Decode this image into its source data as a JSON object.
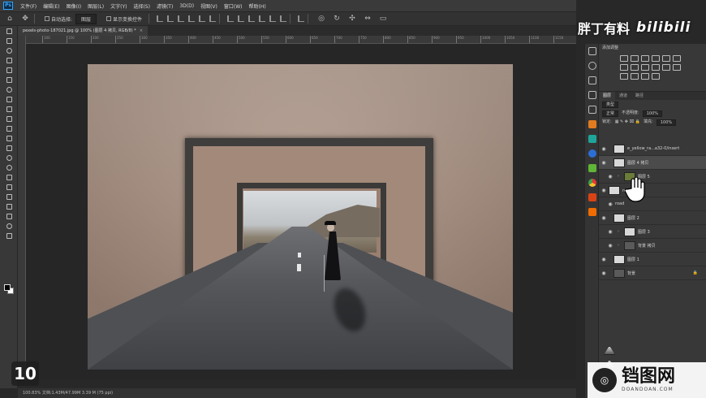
{
  "menubar": {
    "logo": "Ps",
    "items": [
      "文件(F)",
      "编辑(E)",
      "图像(I)",
      "图层(L)",
      "文字(Y)",
      "选择(S)",
      "滤镜(T)",
      "3D(D)",
      "视图(V)",
      "窗口(W)",
      "帮助(H)"
    ]
  },
  "options": {
    "auto_select_label": "自动选择:",
    "auto_select_value": "图层",
    "show_transform_label": "显示变换控件"
  },
  "document": {
    "tab_title": "pexels-photo-187021.jpg @ 100% (图层 4 拷贝, RGB/8) *",
    "close_glyph": "×",
    "ruler_ticks": [
      "100",
      "150",
      "200",
      "250",
      "300",
      "350",
      "400",
      "450",
      "500",
      "550",
      "600",
      "650",
      "700",
      "750",
      "800",
      "850",
      "900",
      "950",
      "1000",
      "1050",
      "1100",
      "1150"
    ]
  },
  "status": {
    "text": "100.83%     文档:1.43M/47.99M    3.39 M (75 ppi)"
  },
  "step": {
    "number": "10"
  },
  "adjustments": {
    "header": "添加调整"
  },
  "layers_panel": {
    "tabs": [
      "图层",
      "通道",
      "路径"
    ],
    "filter_label": "类型",
    "blend_mode": "正常",
    "opacity_label": "不透明度:",
    "opacity_value": "100%",
    "lock_label": "锁定:",
    "fill_label": "填充:",
    "fill_value": "100%",
    "layers": [
      {
        "name": "e_yellow_ra...a32-0/insert",
        "thumb": "light",
        "indent": 0,
        "selected": false
      },
      {
        "name": "图层 4 拷贝",
        "thumb": "light",
        "indent": 0,
        "selected": true
      },
      {
        "name": "图层 5",
        "thumb": "group",
        "indent": 1,
        "selected": false
      },
      {
        "name": "road 拷贝",
        "thumb": "road",
        "indent": 0,
        "selected": false
      },
      {
        "name": "road",
        "thumb": "road",
        "indent": 1,
        "selected": false
      },
      {
        "name": "图层 2",
        "thumb": "light",
        "indent": 0,
        "selected": false
      },
      {
        "name": "图层 3",
        "thumb": "light",
        "indent": 1,
        "selected": false
      },
      {
        "name": "背景 拷贝",
        "thumb": "dark",
        "indent": 1,
        "selected": false
      },
      {
        "name": "图层 1",
        "thumb": "light",
        "indent": 0,
        "selected": false
      },
      {
        "name": "背景",
        "thumb": "dark",
        "indent": 0,
        "selected": false
      }
    ]
  },
  "watermark": {
    "author": "胖丁有料",
    "platform": "bilibili",
    "site_name": "铛图网",
    "site_url": "DOANDOAN.COM"
  },
  "colors": {
    "accent": "#31a8ff",
    "panel_bg": "#383838",
    "canvas_bg": "#262626"
  }
}
